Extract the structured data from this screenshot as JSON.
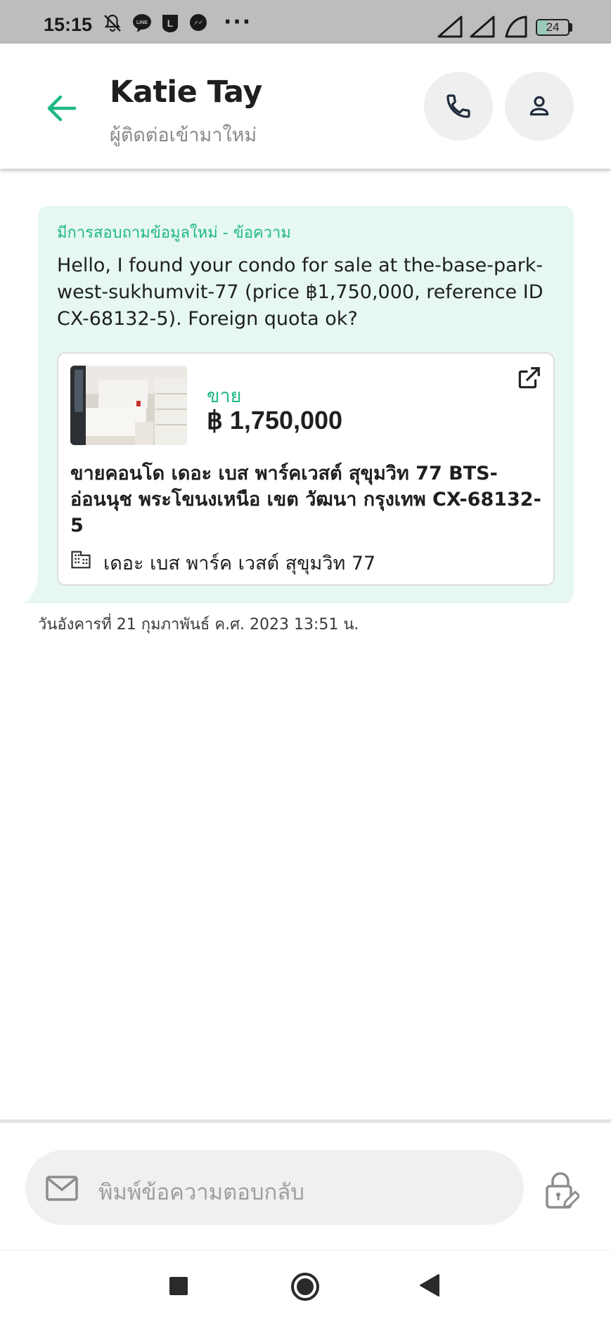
{
  "status_bar": {
    "time": "15:15",
    "more": "···",
    "battery": "24"
  },
  "header": {
    "contact_name": "Katie Tay",
    "contact_subtitle": "ผู้ติดต่อเข้ามาใหม่"
  },
  "message": {
    "heading": "มีการสอบถามข้อมูลใหม่ - ข้อความ",
    "text": "Hello, I found your condo for sale at the-base-park-west-sukhumvit-77 (price ฿1,750,000, reference ID CX-68132-5). Foreign quota ok?",
    "listing": {
      "type": "ขาย",
      "price": "฿ 1,750,000",
      "title": "ขายคอนโด  เดอะ เบส พาร์คเวสต์ สุขุมวิท 77 BTS-อ่อนนุช พระโขนงเหนือ เขต วัฒนา กรุงเทพ CX-68132-5",
      "project": "เดอะ เบส พาร์ค เวสต์ สุขุมวิท 77"
    },
    "timestamp": "วันอังคารที่ 21 กุมภาพันธ์ ค.ศ. 2023 13:51 น."
  },
  "reply": {
    "placeholder": "พิมพ์ข้อความตอบกลับ"
  },
  "colors": {
    "accent": "#1fb885",
    "bubble_bg": "#e6f8f1",
    "status_bar_bg": "#bdbdbd"
  }
}
